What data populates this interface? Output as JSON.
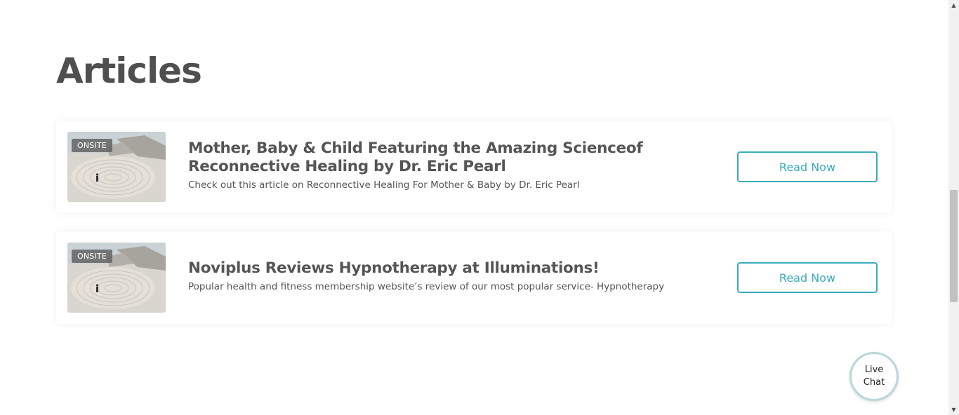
{
  "section": {
    "heading": "Articles"
  },
  "articles": [
    {
      "badge": "ONSITE",
      "title": "Mother, Baby & Child Featuring the Amazing Scienceof Reconnective Healing by Dr. Eric Pearl",
      "description": "Check out this article on Reconnective Healing For Mother & Baby by Dr. Eric Pearl",
      "button": "Read Now",
      "thumbnail": "labyrinth-beach-image"
    },
    {
      "badge": "ONSITE",
      "title": "Noviplus Reviews Hypnotherapy at Illuminations!",
      "description": "Popular health and fitness membership website’s review of our most popular service- Hypnotherapy",
      "button": "Read Now",
      "thumbnail": "labyrinth-beach-image"
    }
  ],
  "live_chat": {
    "line1": "Live",
    "line2": "Chat"
  },
  "colors": {
    "accent": "#3aacbf",
    "heading": "#4f4f4f",
    "text": "#555555"
  },
  "icons": {
    "scroll_up": "triangle-up-icon",
    "scroll_down": "triangle-down-icon"
  }
}
